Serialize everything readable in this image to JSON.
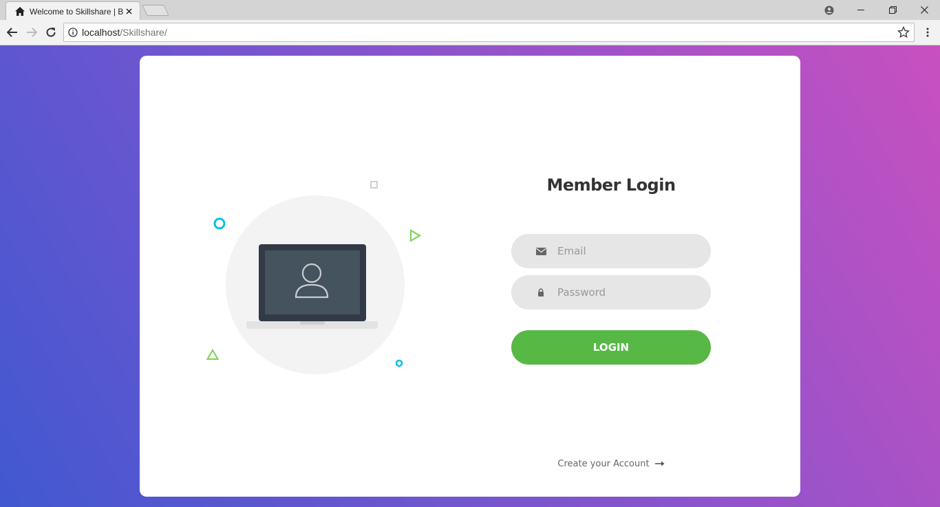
{
  "browser": {
    "tab_title": "Welcome to Skillshare | B",
    "url_host": "localhost",
    "url_path": "/Skillshare/"
  },
  "login": {
    "title": "Member Login",
    "email_placeholder": "Email",
    "password_placeholder": "Password",
    "login_label": "LOGIN",
    "create_account_label": "Create your Account"
  },
  "colors": {
    "gradient_start": "#4158d0",
    "gradient_end": "#c850c0",
    "login_button": "#57b846",
    "field_bg": "#e6e6e6",
    "accent_cyan": "#00c0e8",
    "accent_green": "#82d35c"
  },
  "icons": {
    "tab": "home-icon",
    "email": "envelope-icon",
    "password": "lock-icon",
    "create_account": "arrow-right-icon"
  }
}
